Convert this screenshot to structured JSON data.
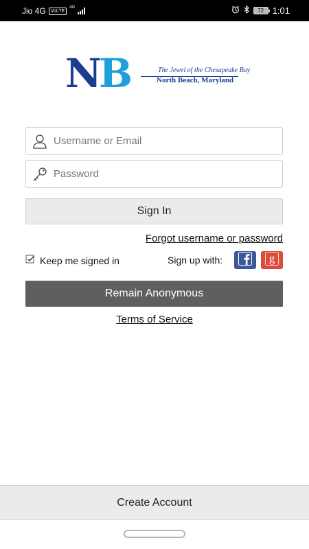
{
  "status_bar": {
    "carrier": "Jio 4G",
    "volte": "VoLTE",
    "network": "4G",
    "battery": "72",
    "time": "1:01",
    "icons": [
      "alarm-icon",
      "bluetooth-icon",
      "battery-icon"
    ]
  },
  "logo": {
    "letters_n": "N",
    "letters_b": "B",
    "tagline": "The Jewel of the Chesapeake Bay",
    "place": "North Beach, Maryland",
    "colors": {
      "dark": "#1a3d8f",
      "light": "#1e9fdc"
    }
  },
  "login": {
    "username_placeholder": "Username or Email",
    "password_placeholder": "Password",
    "sign_in_label": "Sign In",
    "forgot_label": "Forgot username or password",
    "keep_signed_in_label": "Keep me signed in",
    "keep_signed_in_checked": true,
    "signup_with_label": "Sign up with:",
    "remain_anonymous_label": "Remain Anonymous",
    "terms_label": "Terms of Service"
  },
  "footer": {
    "create_account_label": "Create Account"
  },
  "colors": {
    "facebook": "#3b5998",
    "google": "#dd4b39",
    "anonymous_button": "#5f5f5f",
    "light_button": "#ebebeb"
  }
}
